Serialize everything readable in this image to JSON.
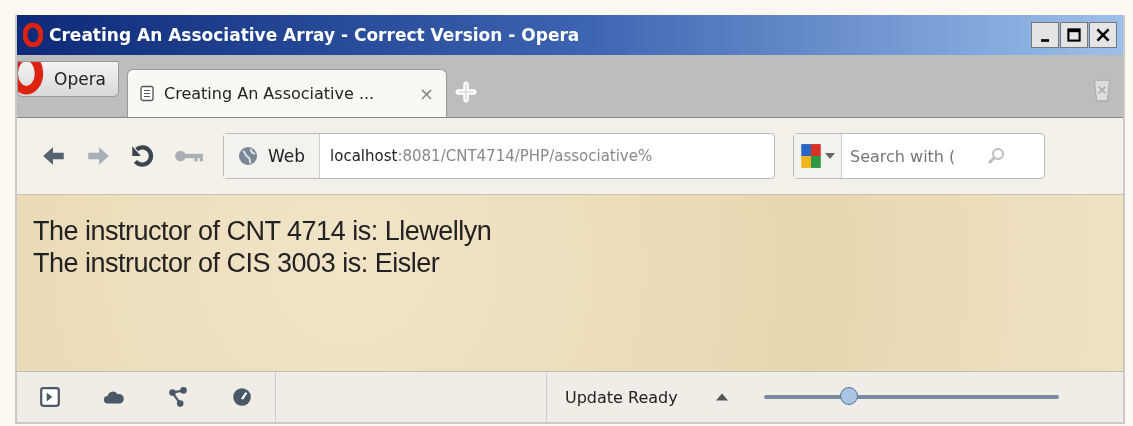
{
  "window": {
    "title": "Creating An Associative Array - Correct Version - Opera"
  },
  "menu_button": {
    "label": "Opera"
  },
  "tabs": [
    {
      "label": "Creating An Associative ...",
      "selected": true,
      "close": "×"
    }
  ],
  "address": {
    "mode": "Web",
    "host": "localhost",
    "rest": ":8081/CNT4714/PHP/associative%"
  },
  "search": {
    "placeholder": "Search with ("
  },
  "content": {
    "lines": [
      "The instructor of CNT 4714 is: Llewellyn",
      "The instructor of CIS 3003 is: Eisler"
    ]
  },
  "status_bar": {
    "text": "Update Ready"
  },
  "zoom": {
    "level": 0.29
  }
}
